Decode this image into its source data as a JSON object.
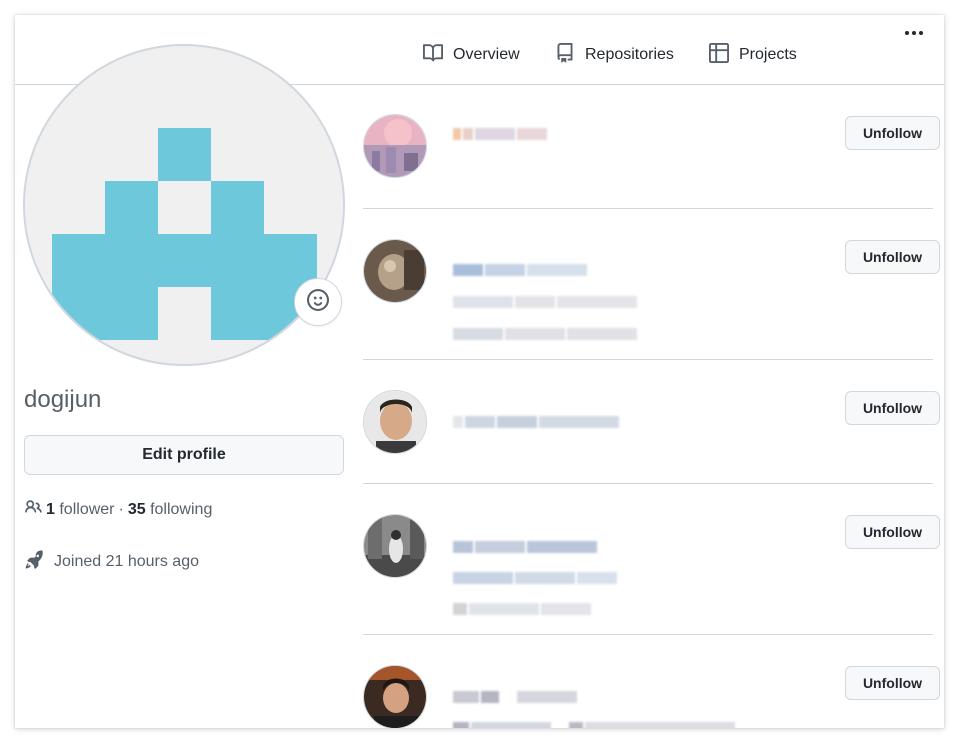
{
  "nav": {
    "tabs": [
      {
        "label": "Overview",
        "icon": "book-icon"
      },
      {
        "label": "Repositories",
        "icon": "repo-icon"
      },
      {
        "label": "Projects",
        "icon": "table-icon"
      }
    ],
    "more_icon": "kebab-horizontal-icon"
  },
  "profile": {
    "username": "dogijun",
    "edit_label": "Edit profile",
    "followers_count": "1",
    "followers_label": "follower",
    "separator": "·",
    "following_count": "35",
    "following_label": "following",
    "joined_text": "Joined 21 hours ago",
    "avatar_color": "#6ec8db",
    "avatar_bg": "#f0f0f0"
  },
  "following_list": [
    {
      "name": "",
      "button_label": "Unfollow"
    },
    {
      "name": "",
      "button_label": "Unfollow"
    },
    {
      "name": "",
      "button_label": "Unfollow"
    },
    {
      "name": "",
      "button_label": "Unfollow"
    },
    {
      "name": "",
      "button_label": "Unfollow"
    }
  ]
}
